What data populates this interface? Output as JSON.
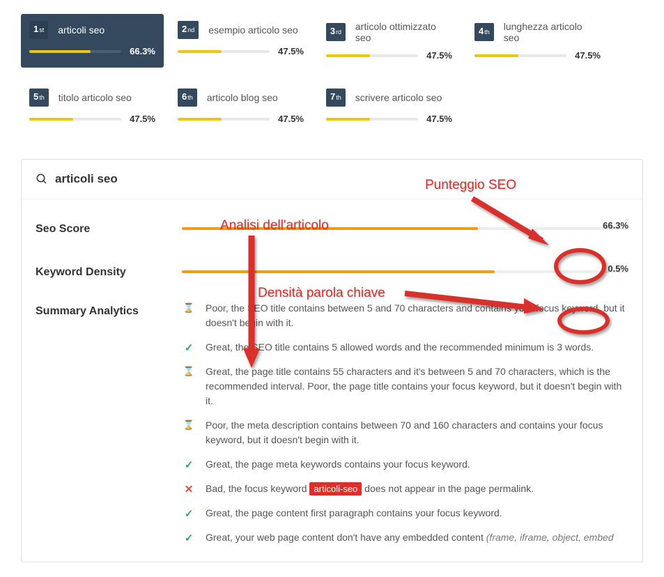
{
  "keywords": [
    {
      "rank": "1",
      "ord": "st",
      "label": "articoli seo",
      "percent": "66.3%",
      "fill": 66.3,
      "active": true
    },
    {
      "rank": "2",
      "ord": "nd",
      "label": "esempio articolo seo",
      "percent": "47.5%",
      "fill": 47.5,
      "active": false
    },
    {
      "rank": "3",
      "ord": "rd",
      "label": "articolo ottimizzato seo",
      "percent": "47.5%",
      "fill": 47.5,
      "active": false
    },
    {
      "rank": "4",
      "ord": "th",
      "label": "lunghezza articolo seo",
      "percent": "47.5%",
      "fill": 47.5,
      "active": false
    },
    {
      "rank": "5",
      "ord": "th",
      "label": "titolo articolo seo",
      "percent": "47.5%",
      "fill": 47.5,
      "active": false
    },
    {
      "rank": "6",
      "ord": "th",
      "label": "articolo blog seo",
      "percent": "47.5%",
      "fill": 47.5,
      "active": false
    },
    {
      "rank": "7",
      "ord": "th",
      "label": "scrivere articolo seo",
      "percent": "47.5%",
      "fill": 47.5,
      "active": false
    }
  ],
  "analysis": {
    "title": "articoli seo",
    "seoScore": {
      "label": "Seo Score",
      "percent": "66.3%",
      "fill": 66.3
    },
    "keywordDensity": {
      "label": "Keyword Density",
      "percent": "0.5%",
      "fill": 70
    },
    "summaryLabel": "Summary Analytics",
    "items": [
      {
        "icon": "warn",
        "text": "Poor, the SEO title contains between 5 and 70 characters and contains your focus keyword, but it doesn't begin with it."
      },
      {
        "icon": "ok",
        "text": "Great, the SEO title contains 5 allowed words and the recommended minimum is 3 words."
      },
      {
        "icon": "warn",
        "text": "Great, the page title contains 55 characters and it's between 5 and 70 characters, which is the recommended interval. Poor, the page title contains your focus keyword, but it doesn't begin with it."
      },
      {
        "icon": "warn",
        "text": "Poor, the meta description contains between 70 and 160 characters and contains your focus keyword, but it doesn't begin with it."
      },
      {
        "icon": "ok",
        "text": "Great, the page meta keywords contains your focus keyword."
      },
      {
        "icon": "bad",
        "prefix": "Bad, the focus keyword ",
        "badge": "articoli-seo",
        "suffix": " does not appear in the page permalink."
      },
      {
        "icon": "ok",
        "text": "Great, the page content first paragraph contains your focus keyword."
      },
      {
        "icon": "ok",
        "prefix": "Great, your web page content don't have any embedded content ",
        "italic": "(frame, iframe, object, embed"
      }
    ]
  },
  "annotations": {
    "punteggio": "Punteggio SEO",
    "analisi": "Analisi dell'articolo",
    "densita": "Densità parola chiave"
  }
}
